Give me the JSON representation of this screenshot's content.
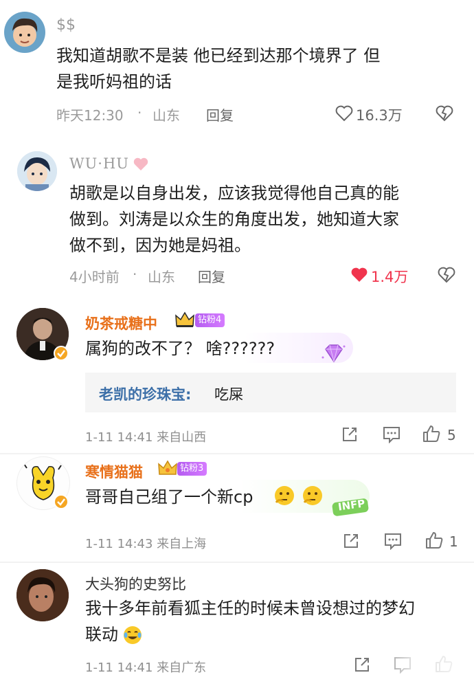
{
  "comments": [
    {
      "username": "$$",
      "text_line1": "我知道胡歌不是装 他已经到达那个境界了 但",
      "text_line2": "是我听妈祖的话",
      "time": "昨天12:30",
      "location": "山东",
      "reply_label": "回复",
      "likes": "16.3万"
    },
    {
      "username": "WU·HU",
      "text_line1": "胡歌是以自身出发，应该我觉得他自己真的能",
      "text_line2": "做到。刘涛是以众生的角度出发，她知道大家",
      "text_line3": "做不到，因为她是妈祖。",
      "time": "4小时前",
      "location": "山东",
      "reply_label": "回复",
      "likes": "1.4万"
    },
    {
      "username": "奶茶戒糖中",
      "fan_badge": "钻粉4",
      "text": "属狗的改不了？ 啥??????",
      "quoted_user": "老凯的珍珠宝:",
      "quoted_text": "吃屎",
      "meta": "1-11 14:41 来自山西",
      "likes": "5"
    },
    {
      "username": "寒情猫猫",
      "fan_badge": "钻粉3",
      "text": "哥哥自己组了一个新cp",
      "sticker_text": "INFP",
      "meta": "1-11 14:43 来自上海",
      "likes": "1"
    },
    {
      "username": "大头狗的史努比",
      "text_line1": "我十多年前看狐主任的时候未曾设想过的梦幻",
      "text_line2": "联动",
      "meta": "1-11 14:41 来自广东"
    }
  ],
  "colors": {
    "like_red": "#f0344d",
    "vip_orange": "#e8701a",
    "link_blue": "#3c6fa8",
    "gray": "#9a9a9a"
  }
}
